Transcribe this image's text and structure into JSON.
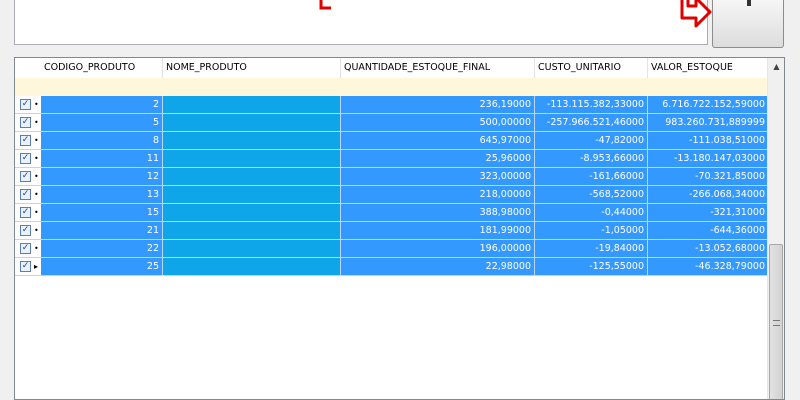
{
  "colors": {
    "selection": "#3399ff",
    "name_column": "#0ea5e9",
    "filter_row": "#fff7dc",
    "annotation_red": "#e00000"
  },
  "icons": {
    "checkbox": "✓",
    "row_marker": "•",
    "current_row_marker": "▸",
    "scroll_up": "▲"
  },
  "grid": {
    "columns": [
      "CODIGO_PRODUTO",
      "NOME_PRODUTO",
      "QUANTIDADE_ESTOQUE_FINAL",
      "CUSTO_UNITARIO",
      "VALOR_ESTOQUE"
    ],
    "rows": [
      {
        "codigo": "2",
        "nome": "",
        "quantidade": "236,19000",
        "custo": "-113.115.382,33000",
        "valor": "6.716.722.152,59000"
      },
      {
        "codigo": "5",
        "nome": "",
        "quantidade": "500,00000",
        "custo": "-257.966.521,46000",
        "valor": "983.260.731,889999"
      },
      {
        "codigo": "8",
        "nome": "",
        "quantidade": "645,97000",
        "custo": "-47,82000",
        "valor": "-111.038,51000"
      },
      {
        "codigo": "11",
        "nome": "",
        "quantidade": "25,96000",
        "custo": "-8.953,66000",
        "valor": "-13.180.147,03000"
      },
      {
        "codigo": "12",
        "nome": "",
        "quantidade": "323,00000",
        "custo": "-161,66000",
        "valor": "-70.321,85000"
      },
      {
        "codigo": "13",
        "nome": "",
        "quantidade": "218,00000",
        "custo": "-568,52000",
        "valor": "-266.068,34000"
      },
      {
        "codigo": "15",
        "nome": "",
        "quantidade": "388,98000",
        "custo": "-0,44000",
        "valor": "-321,31000"
      },
      {
        "codigo": "21",
        "nome": "",
        "quantidade": "181,99000",
        "custo": "-1,05000",
        "valor": "-644,36000"
      },
      {
        "codigo": "22",
        "nome": "",
        "quantidade": "196,00000",
        "custo": "-19,84000",
        "valor": "-13.052,68000"
      },
      {
        "codigo": "25",
        "nome": "",
        "quantidade": "22,98000",
        "custo": "-125,55000",
        "valor": "-46.328,79000"
      }
    ]
  }
}
